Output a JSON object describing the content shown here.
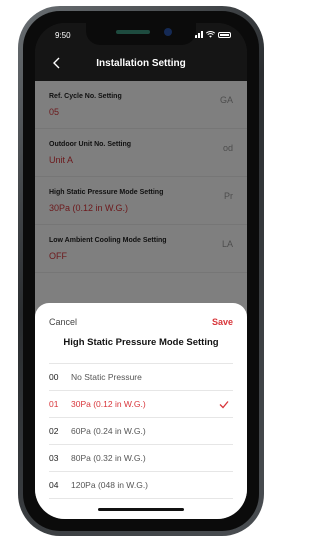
{
  "status": {
    "time": "9:50"
  },
  "nav": {
    "title": "Installation Setting"
  },
  "settings": [
    {
      "label": "Ref. Cycle No. Setting",
      "value": "05",
      "code": "GA"
    },
    {
      "label": "Outdoor Unit No. Setting",
      "value": "Unit A",
      "code": "od"
    },
    {
      "label": "High Static Pressure Mode Setting",
      "value": "30Pa (0.12 in W.G.)",
      "code": "Pr"
    },
    {
      "label": "Low Ambient Cooling Mode Setting",
      "value": "OFF",
      "code": "LA"
    }
  ],
  "sheet": {
    "cancel_label": "Cancel",
    "save_label": "Save",
    "title": "High Static Pressure Mode Setting",
    "options": [
      {
        "code": "00",
        "label": "No Static Pressure",
        "selected": false
      },
      {
        "code": "01",
        "label": "30Pa (0.12 in W.G.)",
        "selected": true
      },
      {
        "code": "02",
        "label": "60Pa (0.24 in W.G.)",
        "selected": false
      },
      {
        "code": "03",
        "label": "80Pa (0.32 in W.G.)",
        "selected": false
      },
      {
        "code": "04",
        "label": "120Pa (048 in W.G.)",
        "selected": false
      }
    ]
  },
  "colors": {
    "accent": "#d8353a",
    "nav_bg": "#2a2a2a"
  }
}
